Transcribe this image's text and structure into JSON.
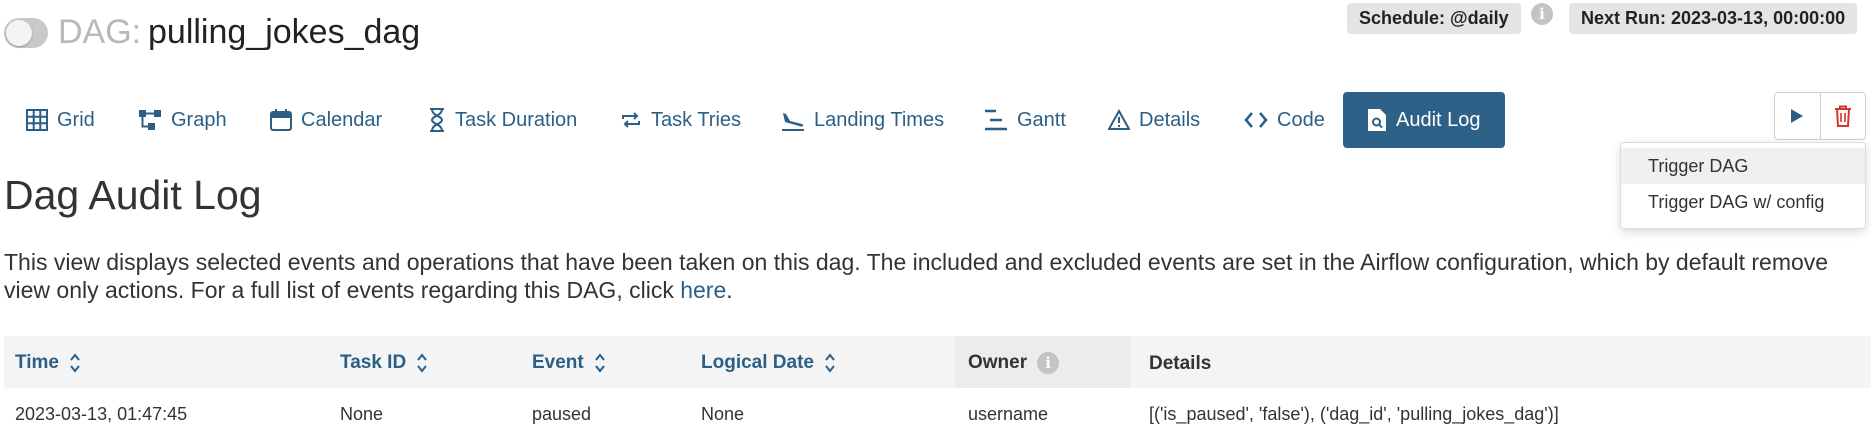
{
  "header": {
    "dag_prefix": "DAG:",
    "dag_name": "pulling_jokes_dag",
    "paused_toggle_on": false,
    "schedule_label": "Schedule: @daily",
    "schedule_info_icon": "info-icon",
    "next_run_label": "Next Run: 2023-03-13, 00:00:00"
  },
  "tabs": [
    {
      "label": "Grid",
      "icon": "grid-icon"
    },
    {
      "label": "Graph",
      "icon": "graph-icon"
    },
    {
      "label": "Calendar",
      "icon": "calendar-icon"
    },
    {
      "label": "Task Duration",
      "icon": "hourglass-icon"
    },
    {
      "label": "Task Tries",
      "icon": "retry-icon"
    },
    {
      "label": "Landing Times",
      "icon": "plane-landing-icon"
    },
    {
      "label": "Gantt",
      "icon": "gantt-icon"
    },
    {
      "label": "Details",
      "icon": "warning-triangle-icon"
    },
    {
      "label": "Code",
      "icon": "code-icon"
    },
    {
      "label": "Audit Log",
      "icon": "file-search-icon",
      "active": true
    }
  ],
  "actions": {
    "trigger_icon": "play-icon",
    "delete_icon": "trash-icon",
    "dropdown": [
      "Trigger DAG",
      "Trigger DAG w/ config"
    ]
  },
  "page": {
    "title": "Dag Audit Log",
    "description": "This view displays selected events and operations that have been taken on this dag. The included and excluded events are set in the Airflow configuration, which by default remove view only actions. For a full list of events regarding this DAG, click ",
    "link_text": "here",
    "description_end": "."
  },
  "table": {
    "columns": [
      "Time",
      "Task ID",
      "Event",
      "Logical Date",
      "Owner",
      "Details"
    ],
    "rows": [
      {
        "time": "2023-03-13, 01:47:45",
        "task_id": "None",
        "event": "paused",
        "logical_date": "None",
        "owner": "username",
        "details": "[('is_paused', 'false'), ('dag_id', 'pulling_jokes_dag')]"
      }
    ]
  },
  "colors": {
    "accent": "#2c5f86",
    "active_tab_bg": "#2d6187",
    "delete_red": "#d9342b",
    "toggle_off": "#c9c9c9"
  }
}
